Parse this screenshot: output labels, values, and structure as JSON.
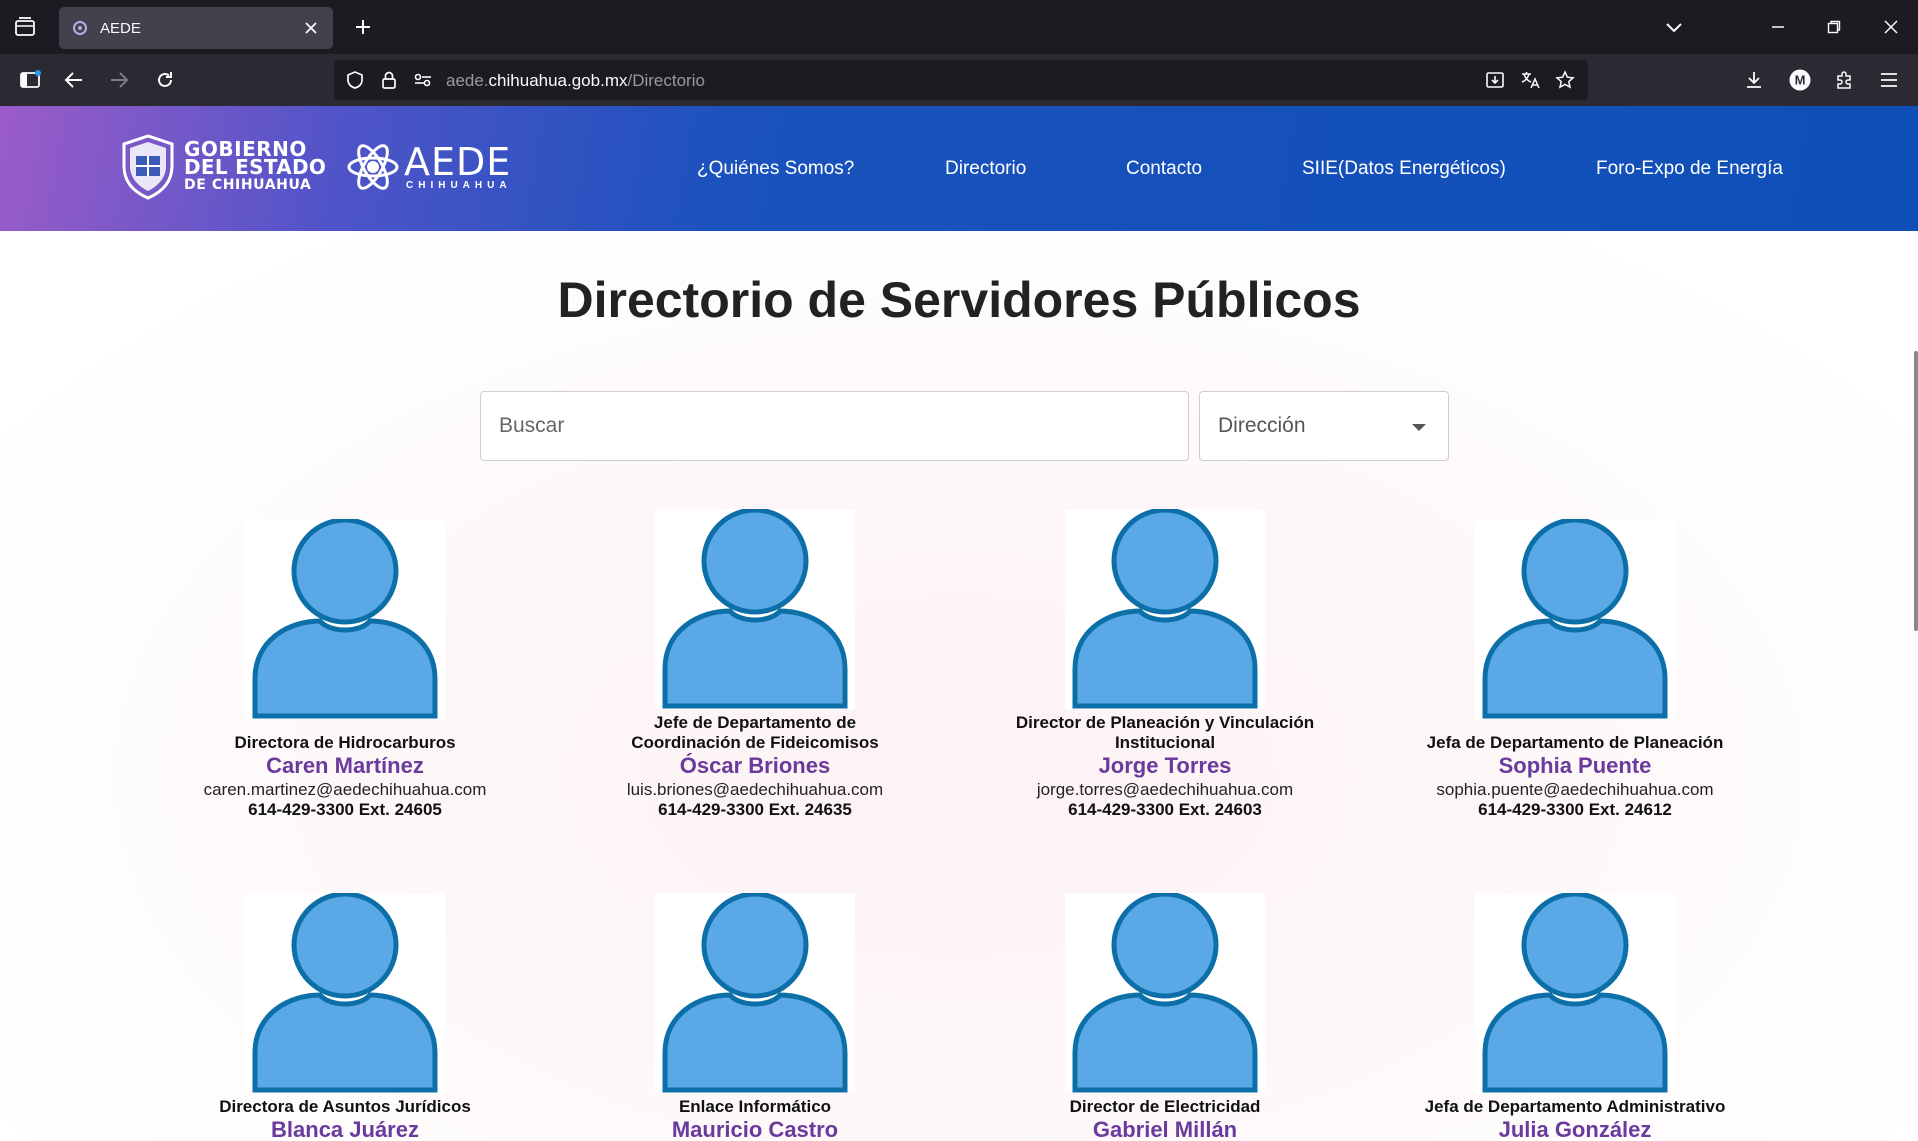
{
  "browser": {
    "tab_title": "AEDE",
    "url_host": "aede.chihuahua.gob.mx",
    "url_prefix": "aede.",
    "url_domain": "chihuahua.gob.mx",
    "url_path": "/Directorio",
    "account_initial": "M"
  },
  "header": {
    "gob_logo": [
      "GOBIERNO",
      "DEL ESTADO",
      "DE CHIHUAHUA"
    ],
    "aede_logo": "AEDE",
    "aede_sub": "CHIHUAHUA",
    "nav": [
      "¿Quiénes Somos?",
      "Directorio",
      "Contacto",
      "SIIE(Datos Energéticos)",
      "Foro-Expo de Energía"
    ]
  },
  "main": {
    "title": "Directorio de Servidores Públicos",
    "search_placeholder": "Buscar",
    "select_value": "Dirección",
    "people": [
      {
        "role": "Directora de Hidrocarburos",
        "name": "Caren Martínez",
        "email": "caren.martinez@aedechihuahua.com",
        "phone": "614-429-3300 Ext. 24605"
      },
      {
        "role": "Jefe de Departamento de Coordinación de Fideicomisos",
        "name": "Óscar Briones",
        "email": "luis.briones@aedechihuahua.com",
        "phone": "614-429-3300 Ext. 24635"
      },
      {
        "role": "Director de Planeación y Vinculación Institucional",
        "name": "Jorge Torres",
        "email": "jorge.torres@aedechihuahua.com",
        "phone": "614-429-3300 Ext. 24603"
      },
      {
        "role": "Jefa de Departamento de Planeación",
        "name": "Sophia Puente",
        "email": "sophia.puente@aedechihuahua.com",
        "phone": "614-429-3300 Ext. 24612"
      },
      {
        "role": "Directora de Asuntos Jurídicos",
        "name": "Blanca Juárez"
      },
      {
        "role": "Enlace Informático",
        "name": "Mauricio Castro"
      },
      {
        "role": "Director de Electricidad",
        "name": "Gabriel Millán"
      },
      {
        "role": "Jefa de Departamento Administrativo",
        "name": "Julia González"
      }
    ]
  },
  "colors": {
    "name_purple": "#6a3a9c",
    "avatar_fill": "#5aa9e6",
    "avatar_stroke": "#0d6fa8",
    "header_blue": "#0e4fb8"
  }
}
